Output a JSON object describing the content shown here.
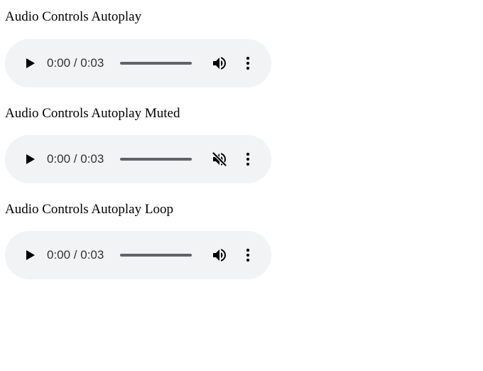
{
  "players": [
    {
      "title": "Audio Controls Autoplay",
      "time": "0:00 / 0:03",
      "volume_icon": "volume-up-icon",
      "muted": false
    },
    {
      "title": "Audio Controls Autoplay Muted",
      "time": "0:00 / 0:03",
      "volume_icon": "volume-off-icon",
      "muted": true
    },
    {
      "title": "Audio Controls Autoplay Loop",
      "time": "0:00 / 0:03",
      "volume_icon": "volume-up-icon",
      "muted": false
    }
  ],
  "colors": {
    "player_background": "#f1f3f4",
    "icon": "#000000",
    "track": "#5f6368"
  }
}
